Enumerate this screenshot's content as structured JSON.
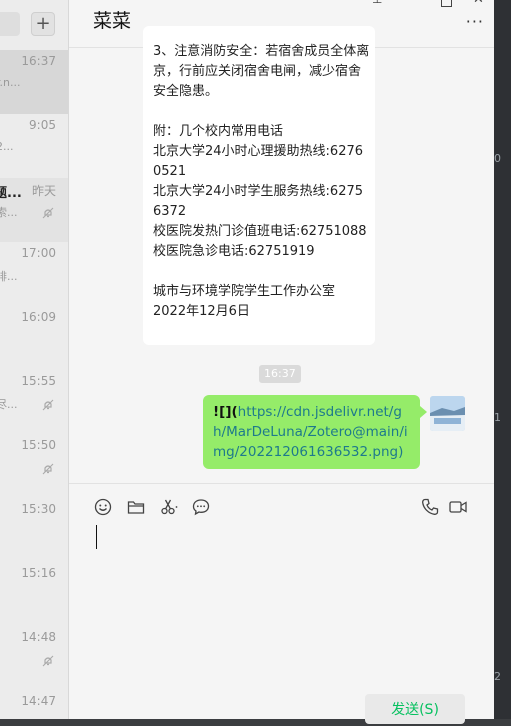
{
  "sidebar": {
    "add_label": "+",
    "items": [
      {
        "time": "16:37",
        "preview": "r.n..."
      },
      {
        "time": "9:05",
        "preview": "2..."
      },
      {
        "name": "题...",
        "time": "昨天",
        "preview": "索..."
      },
      {
        "time": "17:00",
        "preview": "排..."
      },
      {
        "time": "16:09",
        "preview": ""
      },
      {
        "time": "15:55",
        "preview": "尽..."
      },
      {
        "time": "15:50",
        "preview": ""
      },
      {
        "time": "15:30",
        "preview": ""
      },
      {
        "time": "15:16",
        "preview": ""
      },
      {
        "time": "14:48",
        "preview": "\\"
      },
      {
        "time": "14:47",
        "preview": ""
      }
    ]
  },
  "chat": {
    "title": "菜菜",
    "more_label": "···",
    "message1": "3、注意消防安全：若宿舍成员全体离京，行前应关闭宿舍电闸，减少宿舍安全隐患。\n\n附：几个校内常用电话\n北京大学24小时心理援助热线:62760521\n北京大学24小时学生服务热线:62756372\n校医院发热门诊值班电话:62751088\n校医院急诊电话:62751919\n\n城市与环境学院学生工作办公室\n2022年12月6日",
    "timestamp": "16:37",
    "message2_lead": "![](",
    "message2_link": "https://cdn.jsdelivr.net/gh/MarDeLuna/Zotero@main/img/202212061636532.png",
    "message2_tail": ")",
    "send_label": "发送(S)"
  },
  "icons": [
    "emoji-icon",
    "folder-icon",
    "scissors-icon",
    "chat-history-icon",
    "phone-icon",
    "video-icon",
    "mute-icon"
  ],
  "right_strip": [
    "0",
    "1",
    "2"
  ],
  "colors": {
    "accent": "#07c160",
    "bubble_out": "#95ec69",
    "link": "#1e7a8c"
  }
}
